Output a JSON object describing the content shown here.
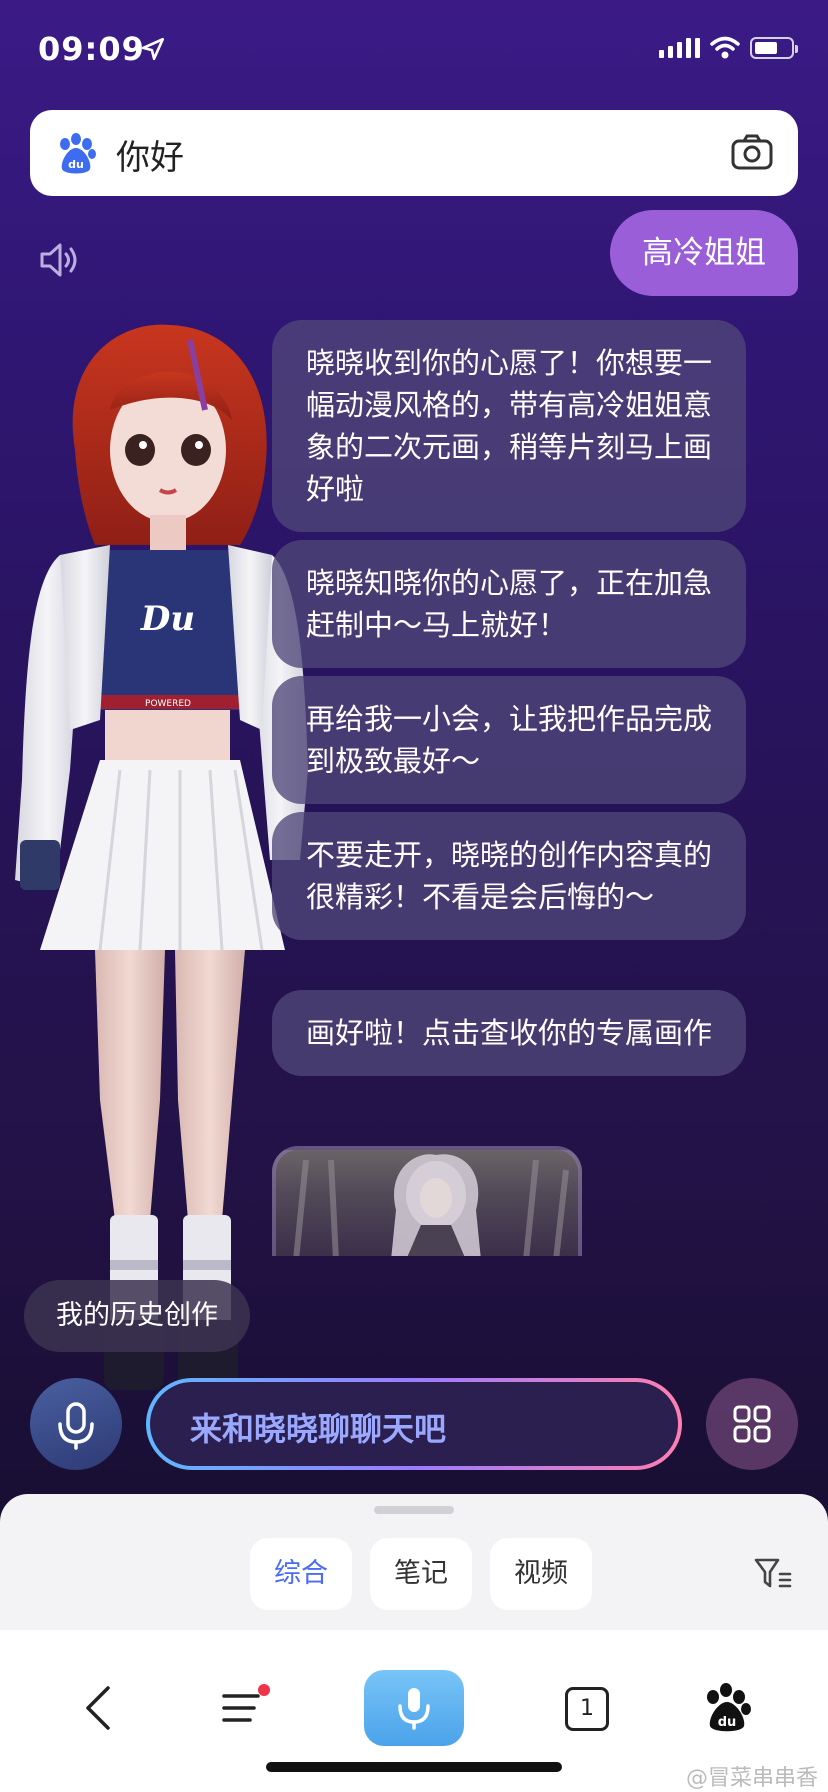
{
  "status": {
    "time": "09:09"
  },
  "search": {
    "query": "你好"
  },
  "user_message": "高冷姐姐",
  "bot_messages": [
    "晓晓收到你的心愿了！你想要一幅动漫风格的，带有高冷姐姐意象的二次元画，稍等片刻马上画好啦",
    "晓晓知晓你的心愿了，正在加急赶制中～马上就好！",
    "再给我一小会，让我把作品完成到极致最好～",
    "不要走开，晓晓的创作内容真的很精彩！不看是会后悔的～",
    "画好啦！点击查收你的专属画作"
  ],
  "avatar": {
    "shirt_text": "Du",
    "band_text": "POWERED"
  },
  "history_button": "我的历史创作",
  "chat_input": {
    "placeholder": "来和晓晓聊聊天吧"
  },
  "tabs": [
    {
      "label": "综合",
      "active": true
    },
    {
      "label": "笔记",
      "active": false
    },
    {
      "label": "视频",
      "active": false
    }
  ],
  "nav": {
    "tab_count": "1"
  },
  "watermark": "@冒菜串串香",
  "colors": {
    "accent": "#4b6bf5",
    "user_bubble": "#9a5fd8"
  }
}
